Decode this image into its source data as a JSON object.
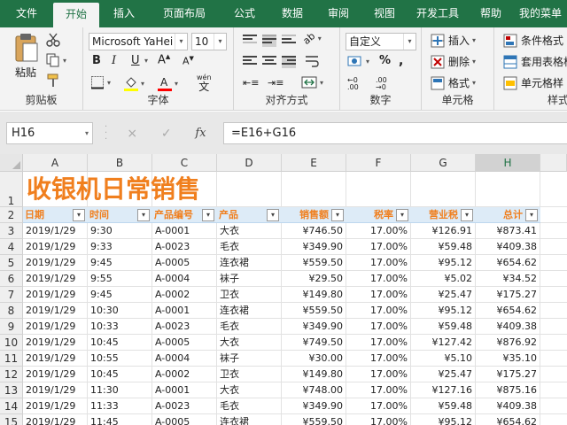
{
  "menu": {
    "tabs": [
      "文件",
      "开始",
      "插入",
      "页面布局",
      "公式",
      "数据",
      "审阅",
      "视图",
      "开发工具",
      "帮助",
      "我的菜单"
    ],
    "active_index": 1
  },
  "ribbon": {
    "clipboard": {
      "paste_label": "粘贴",
      "group_label": "剪贴板"
    },
    "font": {
      "font_name": "Microsoft YaHei",
      "font_size": "10",
      "bold": "B",
      "italic": "I",
      "underline": "U",
      "wen_label": "wén",
      "group_label": "字体"
    },
    "alignment": {
      "group_label": "对齐方式"
    },
    "number": {
      "format": "自定义",
      "group_label": "数字"
    },
    "cells": {
      "insert_label": "插入",
      "delete_label": "删除",
      "format_label": "格式",
      "group_label": "单元格"
    },
    "styles": {
      "conditional_label": "条件格式",
      "table_label": "套用表格格",
      "cell_style_label": "单元格样",
      "group_label": "样式"
    }
  },
  "formula_bar": {
    "name_box": "H16",
    "cancel_icon": "×",
    "enter_icon": "✓",
    "fx": "fx",
    "formula": "=E16+G16"
  },
  "sheet": {
    "columns": [
      "A",
      "B",
      "C",
      "D",
      "E",
      "F",
      "G",
      "H"
    ],
    "rows": [
      "1",
      "2",
      "3",
      "4",
      "5",
      "6",
      "7",
      "8",
      "9",
      "10",
      "11",
      "12",
      "13",
      "14",
      "15"
    ],
    "title": "收银机日常销售",
    "headers": [
      "日期",
      "时间",
      "产品编号",
      "产品",
      "销售额",
      "税率",
      "营业税",
      "总计"
    ],
    "data": [
      [
        "2019/1/29",
        "9:30",
        "A-0001",
        "大衣",
        "¥746.50",
        "17.00%",
        "¥126.91",
        "¥873.41"
      ],
      [
        "2019/1/29",
        "9:33",
        "A-0023",
        "毛衣",
        "¥349.90",
        "17.00%",
        "¥59.48",
        "¥409.38"
      ],
      [
        "2019/1/29",
        "9:45",
        "A-0005",
        "连衣裙",
        "¥559.50",
        "17.00%",
        "¥95.12",
        "¥654.62"
      ],
      [
        "2019/1/29",
        "9:55",
        "A-0004",
        "袜子",
        "¥29.50",
        "17.00%",
        "¥5.02",
        "¥34.52"
      ],
      [
        "2019/1/29",
        "9:45",
        "A-0002",
        "卫衣",
        "¥149.80",
        "17.00%",
        "¥25.47",
        "¥175.27"
      ],
      [
        "2019/1/29",
        "10:30",
        "A-0001",
        "连衣裙",
        "¥559.50",
        "17.00%",
        "¥95.12",
        "¥654.62"
      ],
      [
        "2019/1/29",
        "10:33",
        "A-0023",
        "毛衣",
        "¥349.90",
        "17.00%",
        "¥59.48",
        "¥409.38"
      ],
      [
        "2019/1/29",
        "10:45",
        "A-0005",
        "大衣",
        "¥749.50",
        "17.00%",
        "¥127.42",
        "¥876.92"
      ],
      [
        "2019/1/29",
        "10:55",
        "A-0004",
        "袜子",
        "¥30.00",
        "17.00%",
        "¥5.10",
        "¥35.10"
      ],
      [
        "2019/1/29",
        "10:45",
        "A-0002",
        "卫衣",
        "¥149.80",
        "17.00%",
        "¥25.47",
        "¥175.27"
      ],
      [
        "2019/1/29",
        "11:30",
        "A-0001",
        "大衣",
        "¥748.00",
        "17.00%",
        "¥127.16",
        "¥875.16"
      ],
      [
        "2019/1/29",
        "11:33",
        "A-0023",
        "毛衣",
        "¥349.90",
        "17.00%",
        "¥59.48",
        "¥409.38"
      ],
      [
        "2019/1/29",
        "11:45",
        "A-0005",
        "连衣裙",
        "¥559.50",
        "17.00%",
        "¥95.12",
        "¥654.62"
      ]
    ]
  },
  "colors": {
    "brand": "#217346",
    "title": "#f07f1e",
    "header_fill": "#ddebf7"
  }
}
